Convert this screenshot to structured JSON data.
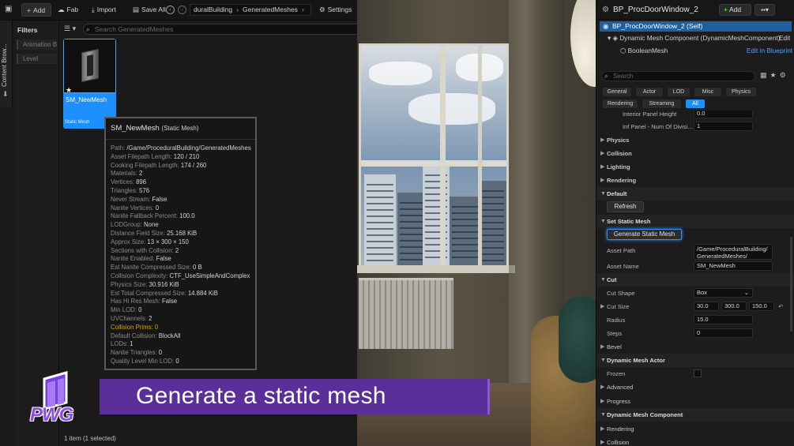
{
  "content_browser": {
    "toolbar": {
      "add_label": "Add",
      "fab_label": "Fab",
      "import_label": "Import",
      "save_all_label": "Save All",
      "breadcrumb": [
        "duralBuilding",
        "GeneratedMeshes"
      ],
      "settings_label": "Settings"
    },
    "side_tab_label": "Content Brow...",
    "filters": {
      "title": "Filters",
      "items": [
        "Animation B",
        "Level"
      ]
    },
    "search": {
      "placeholder": "Search GeneratedMeshes"
    },
    "asset": {
      "name": "SM_NewMesh",
      "type": "Static Mesh"
    },
    "tooltip": {
      "title": "SM_NewMesh",
      "subtitle": "(Static Mesh)",
      "rows": [
        {
          "key": "Path:",
          "value": "/Game/ProceduralBuilding/GeneratedMeshes"
        },
        {
          "key": "Asset Filepath Length:",
          "value": "120 / 210"
        },
        {
          "key": "Cooking Filepath Length:",
          "value": "174 / 260"
        },
        {
          "key": "Materials:",
          "value": "2"
        },
        {
          "key": "Vertices:",
          "value": "896"
        },
        {
          "key": "Triangles:",
          "value": "576"
        },
        {
          "key": "Never Stream:",
          "value": "False"
        },
        {
          "key": "Nanite Vertices:",
          "value": "0"
        },
        {
          "key": "Nanite Fallback Percent:",
          "value": "100.0"
        },
        {
          "key": "LODGroup:",
          "value": "None"
        },
        {
          "key": "Distance Field Size:",
          "value": "25.168 KiB"
        },
        {
          "key": "Approx Size:",
          "value": "13 × 300 × 150"
        },
        {
          "key": "Sections with Collision:",
          "value": "2"
        },
        {
          "key": "Nanite Enabled:",
          "value": "False"
        },
        {
          "key": "Est Nanite Compressed Size:",
          "value": "0 B"
        },
        {
          "key": "Collision Complexity:",
          "value": "CTF_UseSimpleAndComplex"
        },
        {
          "key": "Physics Size:",
          "value": "30.916 KiB"
        },
        {
          "key": "Est Total Compressed Size:",
          "value": "14.884 KiB"
        },
        {
          "key": "Has Hi Res Mesh:",
          "value": "False"
        },
        {
          "key": "Min LOD:",
          "value": "0"
        },
        {
          "key": "UVChannels:",
          "value": "2"
        },
        {
          "key": "Collision Prims:",
          "value": "0"
        },
        {
          "key": "Default Collision:",
          "value": "BlockAll"
        },
        {
          "key": "LODs:",
          "value": "1"
        },
        {
          "key": "Nanite Triangles:",
          "value": "0"
        },
        {
          "key": "Quality Level Min LOD:",
          "value": "0"
        }
      ]
    },
    "footer": "1 item (1 selected)"
  },
  "brand": {
    "logo_text": "PWG",
    "color": "#8b4de6"
  },
  "caption": {
    "text": "Generate a static mesh",
    "background": "#5b2f99"
  },
  "details": {
    "title": "BP_ProcDoorWindow_2",
    "add_label": "Add",
    "tree": {
      "self": "BP_ProcDoorWindow_2 (Self)",
      "component": "Dynamic Mesh Component (DynamicMeshComponent)",
      "component_edit": "Edit",
      "child": "BooleanMesh",
      "child_edit": "Edit in Blueprint"
    },
    "search_placeholder": "Search",
    "category_tabs": [
      "General",
      "Actor",
      "LOD",
      "Misc",
      "Physics",
      "Rendering",
      "Streaming",
      "All"
    ],
    "active_tab": "All",
    "properties": {
      "interior_panel_height": {
        "label": "Interior Panel Height",
        "value": "0.0"
      },
      "inf_panel_num": {
        "label": "Inf Panel - Num Of Divisi...",
        "value": "1"
      },
      "physics": "Physics",
      "collision": "Collision",
      "lighting": "Lighting",
      "rendering": "Rendering",
      "default": "Default",
      "refresh": "Refresh",
      "set_static_mesh": "Set Static Mesh",
      "generate_button": "Generate Static Mesh",
      "asset_path": {
        "label": "Asset Path",
        "value_line1": "/Game/ProceduralBuilding/",
        "value_line2": "GeneratedMeshes/"
      },
      "asset_name": {
        "label": "Asset Name",
        "value": "SM_NewMesh"
      },
      "cut": "Cut",
      "cut_shape": {
        "label": "Cut Shape",
        "value": "Box"
      },
      "cut_size": {
        "label": "Cut Size",
        "x": "30.0",
        "y": "300.0",
        "z": "150.0"
      },
      "radius": {
        "label": "Radius",
        "value": "15.0"
      },
      "steps": {
        "label": "Steps",
        "value": "0"
      },
      "bevel": "Bevel",
      "dynamic_mesh_actor": "Dynamic Mesh Actor",
      "frozen": {
        "label": "Frozen"
      },
      "advanced": "Advanced",
      "progress": "Progress",
      "dynamic_mesh_component": "Dynamic Mesh Component",
      "rendering2": "Rendering",
      "collision2": "Collision"
    }
  }
}
